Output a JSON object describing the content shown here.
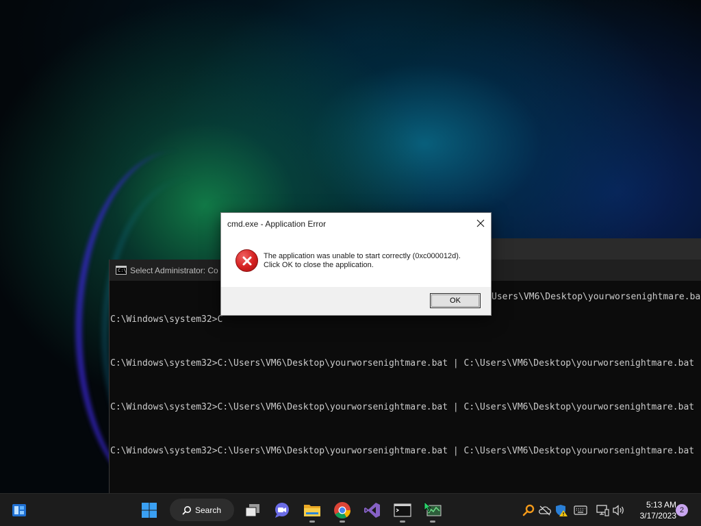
{
  "console": {
    "title": "Select Administrator:  Co",
    "lines": [
      "C:\\Windows\\system32>C",
      "C:\\Windows\\system32>C:\\Users\\VM6\\Desktop\\yourworsenightmare.bat | C:\\Users\\VM6\\Desktop\\yourworsenightmare.bat",
      "C:\\Windows\\system32>C:\\Users\\VM6\\Desktop\\yourworsenightmare.bat | C:\\Users\\VM6\\Desktop\\yourworsenightmare.bat",
      "C:\\Windows\\system32>C:\\Users\\VM6\\Desktop\\yourworsenightmare.bat | C:\\Users\\VM6\\Desktop\\yourworsenightmare.bat"
    ],
    "line1_tail": "Users\\VM6\\Desktop\\yourworsenightmare.ba"
  },
  "dialog": {
    "title": "cmd.exe - Application Error",
    "message_line1": "The application was unable to start correctly (0xc000012d).",
    "message_line2": "Click OK to close the application.",
    "ok_label": "OK",
    "icon": "error-icon"
  },
  "taskbar": {
    "search_label": "Search",
    "pinned": [
      "widgets-icon",
      "start-icon",
      "task-view-icon",
      "chat-icon",
      "file-explorer-icon",
      "chrome-icon",
      "visual-studio-icon",
      "terminal-icon",
      "task-manager-icon"
    ],
    "tray": [
      "search-tool-icon",
      "onedrive-icon",
      "security-warning-icon",
      "keyboard-icon",
      "network-icon",
      "volume-icon"
    ],
    "time": "5:13 AM",
    "date": "3/17/2023",
    "notification_count": "2"
  },
  "colors": {
    "accent": "#0078d4",
    "error_red": "#d42020",
    "console_bg": "#0c0c0c",
    "taskbar_bg": "#1c1c1c"
  }
}
